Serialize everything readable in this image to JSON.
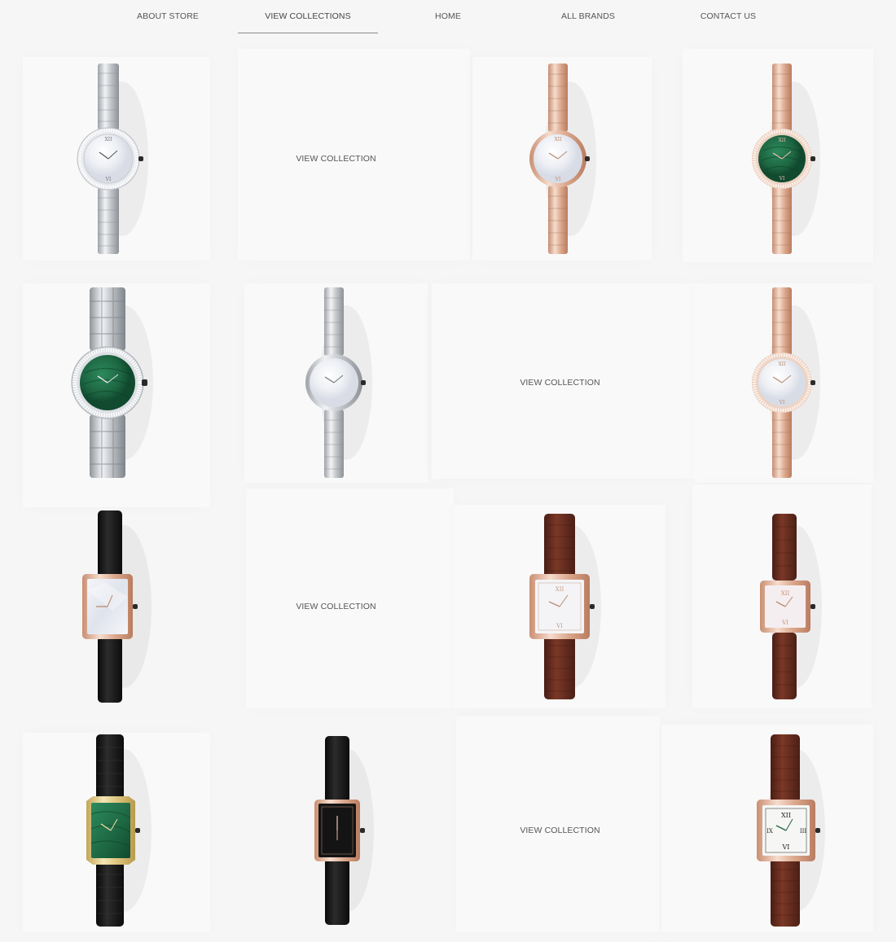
{
  "nav": {
    "items": [
      {
        "label": "ABOUT STORE"
      },
      {
        "label": "VIEW COLLECTIONS"
      },
      {
        "label": "HOME"
      },
      {
        "label": "ALL BRANDS"
      },
      {
        "label": "CONTACT US"
      }
    ],
    "active_index": 1
  },
  "grid": {
    "view_collection_label": "VIEW COLLECTION",
    "rows": [
      [
        "watch-silver-round-pearl-diamond",
        "view-collection",
        "watch-rose-round-pearl",
        "watch-rose-round-green-diamond"
      ],
      [
        "watch-silver-round-green-diamond",
        "watch-silver-round-pearl",
        "view-collection",
        "watch-rose-round-pearl-diamond"
      ],
      [
        "watch-rose-rect-pearl-black-leather",
        "view-collection",
        "watch-rose-square-pearl-brown-leather",
        "watch-rose-square-pearl-brown-leather-small"
      ],
      [
        "watch-gold-rect-green-black-leather",
        "watch-rose-rect-black-black-leather",
        "view-collection",
        "watch-rose-square-white-brown-leather"
      ]
    ]
  },
  "colors": {
    "background": "#f6f6f6",
    "text": "#555555",
    "steel": "#c9ccd0",
    "rose_gold": "#e3b9a1",
    "yellow_gold": "#dcc27a",
    "malachite": "#1f6b47",
    "pearl": "#f2f3f6",
    "black_leather": "#161616",
    "brown_leather": "#6a2f22"
  }
}
